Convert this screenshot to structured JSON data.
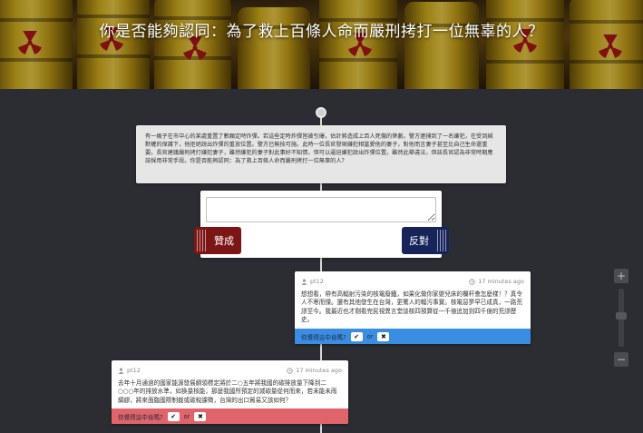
{
  "header": {
    "title": "你是否能夠認同：為了救上百條人命而嚴刑拷打一位無辜的人？"
  },
  "question": {
    "text": "有一瘋子在市中心的某處重置了數顆定時炸彈。若這些定時炸彈皆被引爆，估計將造成上百人死傷的慘劇。警方逮捕到了一名嫌犯，在受到緘默權的保護下，他拒絕說出炸彈的重放位置。警方已無技可施。此時一位長官發現嫌犯相當愛他的妻子，對他而言妻子甚至比自己生命還重要。長官建議嚴刑拷打嫌犯妻子，雖然嫌犯的妻子對此事好不知情，但可以逼迫嫌犯說出炸彈位置。雖然此舉違法，但該長官認為非常時期應該採用非常手段。你是否能夠認同：為了救上百條人命而嚴刑拷打一位無辜的人？"
  },
  "reply": {
    "agree_label": "贊成",
    "oppose_label": "反對"
  },
  "comments": [
    {
      "user": "pt12",
      "time": "17 minutes ago",
      "text": "想想看，帶有高輻射污染的核電廢鐵，如果化做你家嬰兒床的欄杆會怎麼樣！？真令人不寒而慄。還有其他發生在台灣，更驚人的輻污事實。核電惡夢早已成真，一路荒謬至今。我最近也才剛看完民視異言堂談核四預算從一千億追加到四千億的荒謬歷史。",
      "prompt": "你覺得這中肯嗎?",
      "or": "or",
      "color": "#3b8de2"
    },
    {
      "user": "pt12",
      "time": "17 minutes ago",
      "text": "去年十月通過的國家能源發展綱領標定將於二○五年將我國的碳排放量下降到二○○○年的排放水準，如換量核能，那麼我國所預定的減碳量從何而來，若未能未雨綢繆，將來面臨國際制裁或碳稅課徵，台灣的出口貿易又該如何？",
      "prompt": "你覺得這中肯嗎?",
      "or": "or",
      "color": "#e0646a"
    }
  ],
  "zoom": {
    "plus": "+",
    "minus": "−"
  },
  "icons": {
    "user": "user-icon",
    "clock": "clock-icon",
    "check": "✔",
    "cross": "✖"
  }
}
